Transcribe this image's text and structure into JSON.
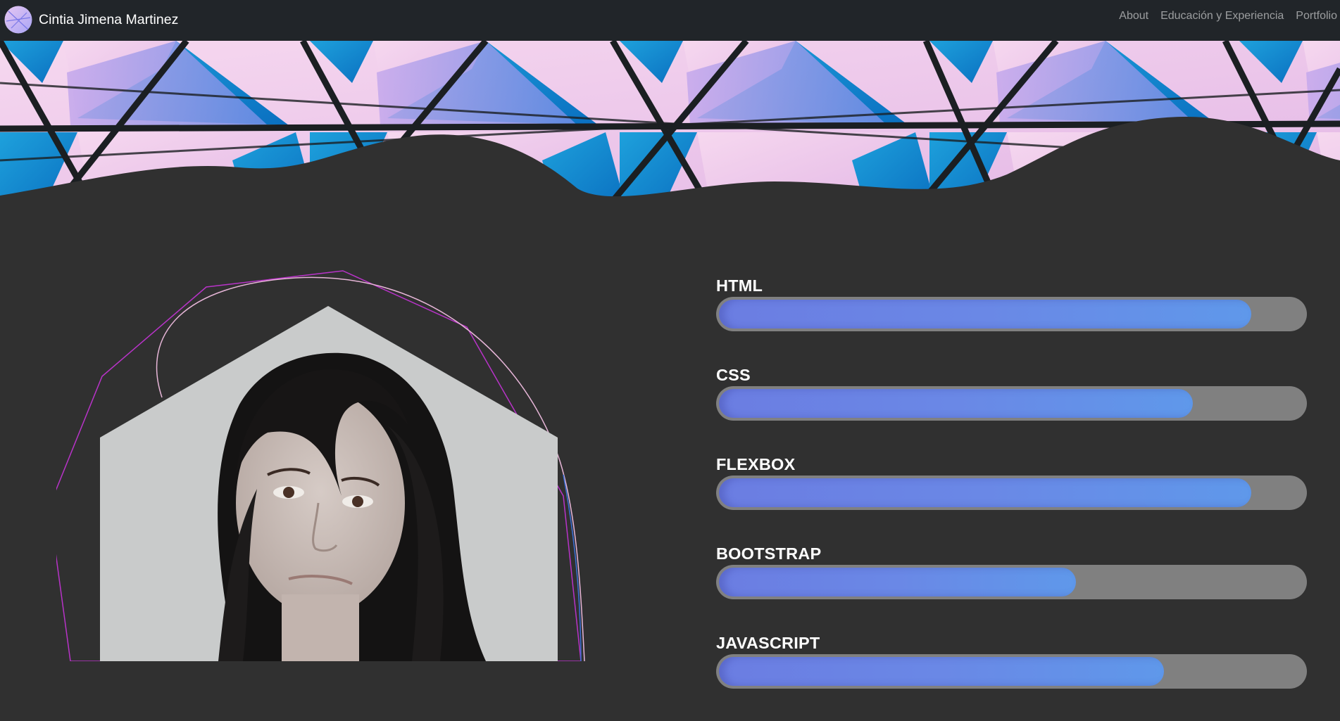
{
  "navbar": {
    "brand_name": "Cintia Jimena Martinez",
    "links": [
      {
        "label": "About"
      },
      {
        "label": "Educación y Experiencia"
      },
      {
        "label": "Portfolio"
      }
    ]
  },
  "hero": {
    "image_description_icon": "geometric-glass-roof-icon"
  },
  "profile": {
    "photo_icon": "profile-photo-icon"
  },
  "skills": [
    {
      "label": "HTML",
      "level": 0.91
    },
    {
      "label": "CSS",
      "level": 0.81
    },
    {
      "label": "FLEXBOX",
      "level": 0.91
    },
    {
      "label": "BOOTSTRAP",
      "level": 0.61
    },
    {
      "label": "JAVASCRIPT",
      "level": 0.76
    }
  ],
  "colors": {
    "navbar_bg": "#212529",
    "page_bg": "#303030",
    "bar_track": "#808080",
    "bar_fill_start": "#6b7de2",
    "bar_fill_end": "#5f98ea",
    "accent_magenta": "#b833c8"
  }
}
